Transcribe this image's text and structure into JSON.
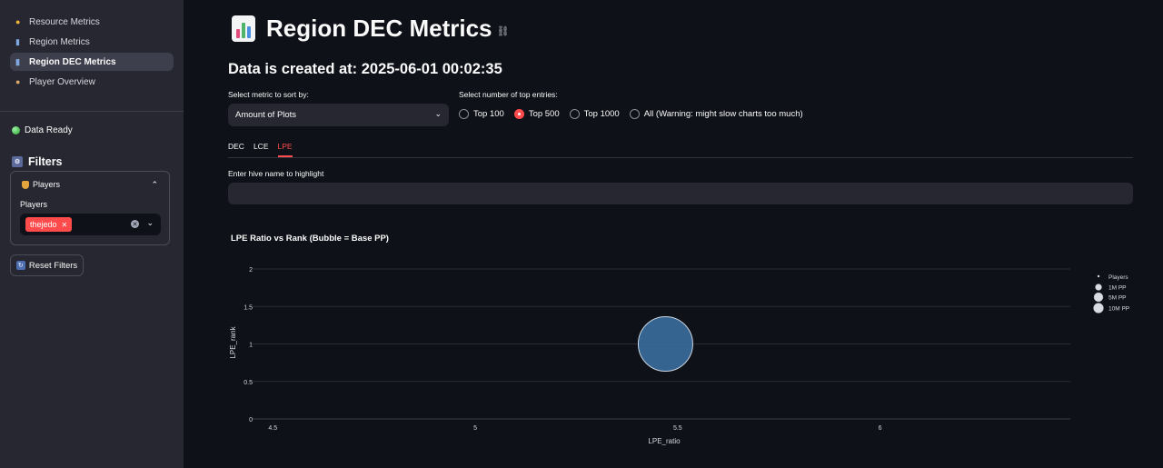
{
  "sidebar": {
    "nav": [
      {
        "label": "Resource Metrics",
        "icon": "yellow-circle-icon",
        "active": false
      },
      {
        "label": "Region Metrics",
        "icon": "bar-chart-icon",
        "active": false
      },
      {
        "label": "Region DEC Metrics",
        "icon": "bar-chart-icon",
        "active": true
      },
      {
        "label": "Player Overview",
        "icon": "people-icon",
        "active": false
      }
    ],
    "status": "Data Ready",
    "filters_title": "Filters",
    "players_expander_title": "Players",
    "players_label": "Players",
    "selected_players": [
      "thejedo"
    ],
    "reset_label": "Reset Filters"
  },
  "main": {
    "title": "Region DEC Metrics",
    "subtitle": "Data is created at: 2025-06-01 00:02:35",
    "sort_label": "Select metric to sort by:",
    "sort_value": "Amount of Plots",
    "top_label": "Select number of top entries:",
    "top_options": [
      "Top 100",
      "Top 500",
      "Top 1000",
      "All (Warning: might slow charts too much)"
    ],
    "top_selected": "Top 500",
    "tabs": [
      "DEC",
      "LCE",
      "LPE"
    ],
    "active_tab": "LPE",
    "highlight_label": "Enter hive name to highlight",
    "highlight_value": ""
  },
  "colors": {
    "accent": "#ff4b4b",
    "bubble": "#3b6e9e",
    "background": "#0e1117",
    "sidebar": "#262730"
  },
  "chart_data": {
    "type": "scatter",
    "title": "LPE Ratio vs Rank (Bubble = Base PP)",
    "xlabel": "LPE_ratio",
    "ylabel": "LPE_rank",
    "xlim": [
      4.45,
      6.47
    ],
    "ylim": [
      0,
      2
    ],
    "x_ticks": [
      "4.5",
      "5",
      "5.5",
      "6"
    ],
    "x_tick_values": [
      4.5,
      5,
      5.5,
      6
    ],
    "y_ticks": [
      "0",
      "0.5",
      "1",
      "1.5",
      "2"
    ],
    "y_tick_values": [
      0,
      0.5,
      1,
      1.5,
      2
    ],
    "grid": true,
    "legend_position": "top-right",
    "legend": {
      "title": "Players",
      "entries": [
        "1M PP",
        "5M PP",
        "10M PP"
      ]
    },
    "points": [
      {
        "x": 5.47,
        "y": 1,
        "player": "thejedo"
      }
    ]
  }
}
